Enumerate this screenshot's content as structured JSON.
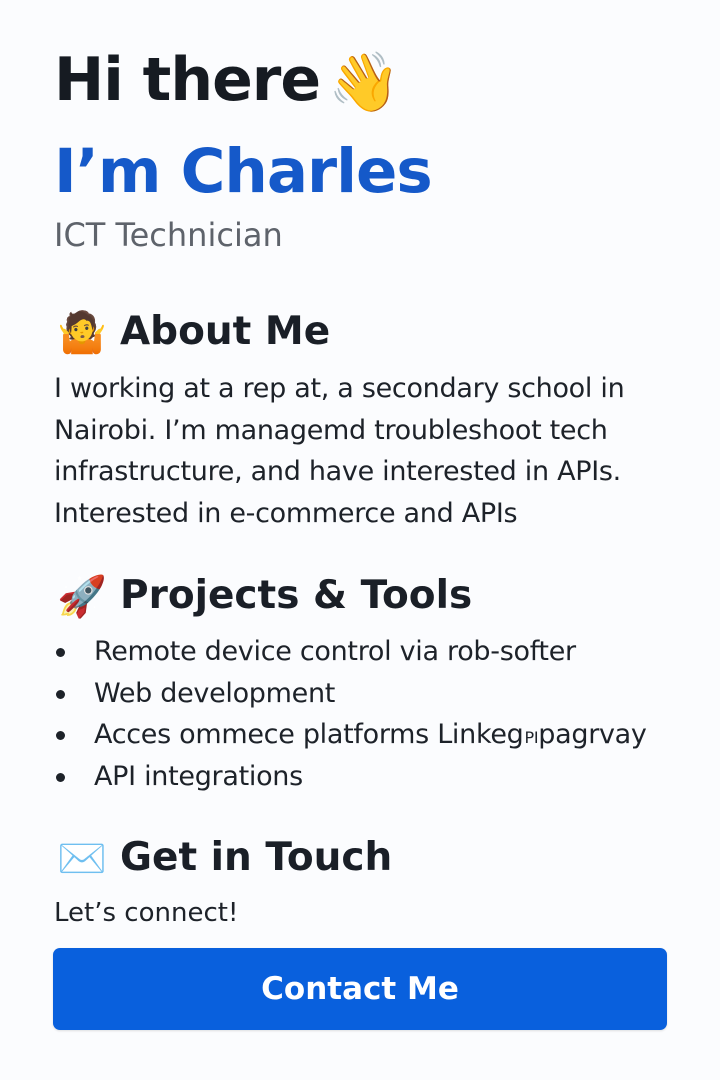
{
  "hero": {
    "greeting": "Hi there",
    "greeting_emoji": "👋",
    "name": "I’m Charles",
    "role": "ICT Technician"
  },
  "about": {
    "emoji": "🤷",
    "heading": "About Me",
    "lines": [
      "I working at a rep at, a secondary school in",
      "Nairobi. I’m managemd troubleshoot tech",
      "infrastructure, and have interested in APIs.",
      "Interested in e-commerce and APIs"
    ]
  },
  "projects": {
    "emoji": "🚀",
    "heading": "Projects & Tools",
    "items": [
      "Remote device control via rob-softer",
      "Web development",
      "Acces ommece platforms Linkeg",
      "API integrations"
    ],
    "item_3_suffix_small": "PI",
    "item_3_suffix": "pagrvay"
  },
  "contact": {
    "emoji": "✉️",
    "heading": "Get in Touch",
    "text": "Let’s connect!",
    "button_label": "Contact Me"
  },
  "colors": {
    "name_blue": "#1559c9",
    "button_blue": "#0960dd",
    "text_dark": "#1d2229",
    "muted_gray": "#5e636b"
  }
}
